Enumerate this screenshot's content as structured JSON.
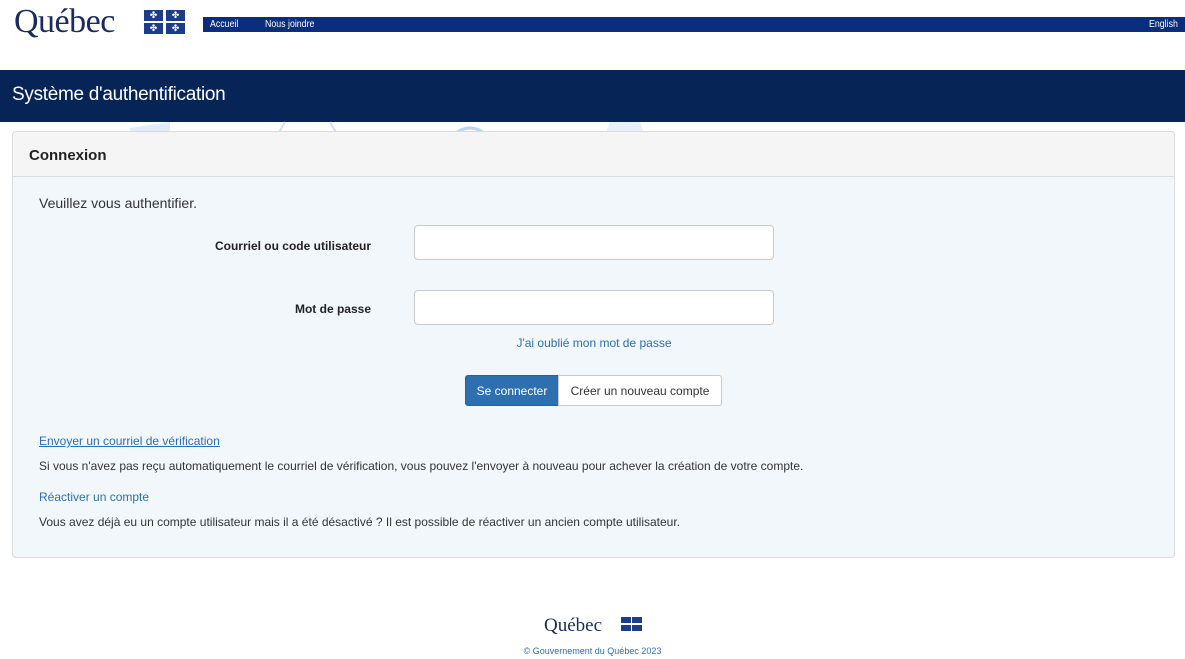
{
  "gov_bar": {
    "logo_text": "Québec",
    "nav": [
      "Accueil",
      "Nous joindre"
    ],
    "language_link": "English"
  },
  "system_header": {
    "title": "Système d'authentification"
  },
  "panel": {
    "title": "Connexion",
    "intro": "Veuillez vous authentifier.",
    "fields": {
      "user_label": "Courriel ou code utilisateur",
      "user_value": "",
      "password_label": "Mot de passe",
      "password_value": ""
    },
    "forgot_link": "J'ai oublié mon mot de passe",
    "buttons": {
      "login": "Se connecter",
      "create": "Créer un nouveau compte"
    },
    "verification": {
      "link": "Envoyer un courriel de vérification",
      "description": "Si vous n'avez pas reçu automatiquement le courriel de vérification, vous pouvez l'envoyer à nouveau pour achever la création de votre compte."
    },
    "reactivate": {
      "link": "Réactiver un compte",
      "description": "Vous avez déjà eu un compte utilisateur mais il a été désactivé ? Il est possible de réactiver un ancien compte utilisateur."
    }
  },
  "footer": {
    "logo_text": "Québec",
    "copyright": "© Gouvernement du Québec 2023"
  },
  "colors": {
    "nav_strip": "#0b2e7c",
    "header": "#062456",
    "panel_bg": "#f2f7fc",
    "primary_button": "#2e6fb0",
    "link": "#2a6fb5"
  },
  "icons": {
    "flag": "fleur-de-lis-flag-icon"
  }
}
